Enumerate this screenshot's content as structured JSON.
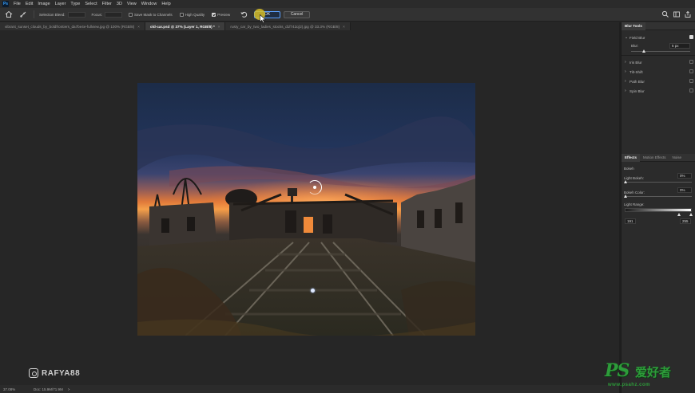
{
  "app": {
    "logo_text": "Ps"
  },
  "menu": [
    "File",
    "Edit",
    "Image",
    "Layer",
    "Type",
    "Select",
    "Filter",
    "3D",
    "View",
    "Window",
    "Help"
  ],
  "options": {
    "selection_bleed_label": "Selection Bleed:",
    "focus_label": "Focus:",
    "save_mask_label": "Save Mask to Channels",
    "high_quality_label": "High Quality",
    "preview_label": "Preview",
    "ok_label": "OK",
    "cancel_label": "Cancel",
    "save_mask_checked": false,
    "high_quality_checked": false,
    "preview_checked": true
  },
  "tabs": [
    {
      "label": "vibrant_sunset_clouds_by_boldfrontiers_da7be4e-fullview.jpg @ 100% (RGB/8)",
      "close": "×",
      "active": false
    },
    {
      "label": "old-car.psd @ 37% (Layer 1, RGB/8) *",
      "close": "×",
      "active": true
    },
    {
      "label": "rusty_car_by_two_ladies_stocks_d1f742q(2).jpg @ 33.3% (RGB/8)",
      "close": "×",
      "active": false
    }
  ],
  "panel": {
    "title": "Blur Tools",
    "field_blur": {
      "label": "Field Blur",
      "checked": true,
      "blur_label": "Blur:",
      "blur_value": "5 px",
      "blur_fraction": 0.22
    },
    "other_blurs": [
      {
        "label": "Iris Blur",
        "checked": false
      },
      {
        "label": "Tilt-Shift",
        "checked": false
      },
      {
        "label": "Path Blur",
        "checked": false
      },
      {
        "label": "Spin Blur",
        "checked": false
      }
    ],
    "effects_tabs": [
      "Effects",
      "Motion Effects",
      "Noise"
    ],
    "bokeh_label": "Bokeh",
    "light_bokeh_label": "Light Bokeh:",
    "light_bokeh_value": "0%",
    "bokeh_color_label": "Bokeh Color:",
    "bokeh_color_value": "0%",
    "light_range_label": "Light Range:",
    "light_range_min": "191",
    "light_range_max": "255"
  },
  "status": {
    "zoom": "37.08%",
    "doc": "Doc: 15.9M/71.9M",
    "arrow": ">"
  },
  "watermark": {
    "instagram_handle": "RAFYA88",
    "ps_big": "PS",
    "ps_cn": "爱好者",
    "ps_url": "www.psahz.com"
  },
  "colors": {
    "accent": "#5aa0ff",
    "cursor": "#d7be28",
    "watermark_green": "#2d9c3a"
  }
}
